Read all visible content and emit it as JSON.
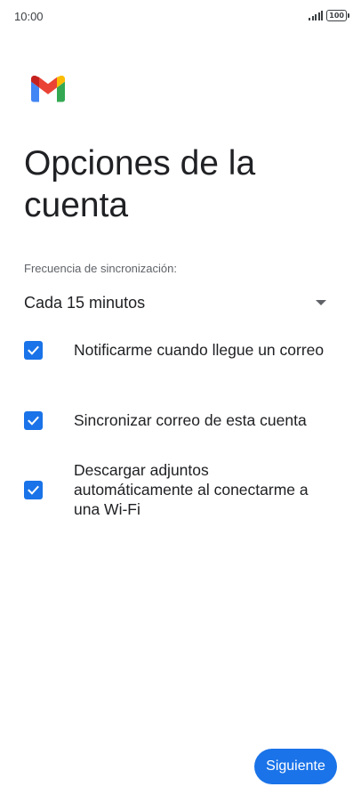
{
  "status_bar": {
    "time": "10:00",
    "battery": "100",
    "icons": [
      "signal-icon",
      "battery-icon"
    ]
  },
  "header": {
    "logo": "gmail-logo",
    "title": "Opciones de la cuenta"
  },
  "sync": {
    "label": "Frecuencia de sincronización:",
    "selected": "Cada 15 minutos"
  },
  "options": [
    {
      "label": "Notificarme cuando llegue un correo",
      "checked": true
    },
    {
      "label": "Sincronizar correo de esta cuenta",
      "checked": true
    },
    {
      "label": "Descargar adjuntos automáticamente al conectarme a una Wi-Fi",
      "checked": true
    }
  ],
  "footer": {
    "next_label": "Siguiente"
  },
  "colors": {
    "accent": "#1a73e8",
    "text": "#202124",
    "secondary_text": "#5f6368",
    "gmail_red": "#ea4335",
    "gmail_blue": "#4285f4",
    "gmail_green": "#34a853",
    "gmail_yellow": "#fbbc04"
  }
}
